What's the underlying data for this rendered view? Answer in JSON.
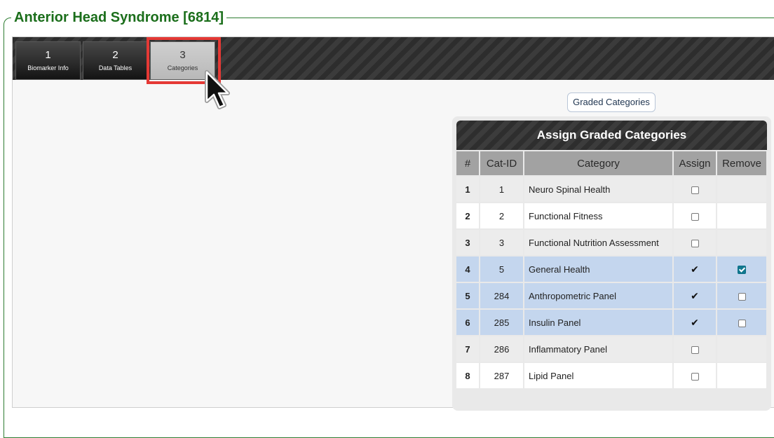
{
  "page": {
    "title": "Anterior Head Syndrome [6814]"
  },
  "tabs": [
    {
      "number": "1",
      "label": "Biomarker Info",
      "active": false
    },
    {
      "number": "2",
      "label": "Data Tables",
      "active": false
    },
    {
      "number": "3",
      "label": "Categories",
      "active": true
    }
  ],
  "graded_button": {
    "label": "Graded Categories"
  },
  "assign_table": {
    "title": "Assign Graded Categories",
    "headers": [
      "#",
      "Cat-ID",
      "Category",
      "Assign",
      "Remove"
    ],
    "rows": [
      {
        "num": "1",
        "cat_id": "1",
        "category": "Neuro Spinal Health",
        "assigned": false,
        "remove": null
      },
      {
        "num": "2",
        "cat_id": "2",
        "category": "Functional Fitness",
        "assigned": false,
        "remove": null
      },
      {
        "num": "3",
        "cat_id": "3",
        "category": "Functional Nutrition Assessment",
        "assigned": false,
        "remove": null
      },
      {
        "num": "4",
        "cat_id": "5",
        "category": "General Health",
        "assigned": true,
        "remove": true
      },
      {
        "num": "5",
        "cat_id": "284",
        "category": "Anthropometric Panel",
        "assigned": true,
        "remove": false
      },
      {
        "num": "6",
        "cat_id": "285",
        "category": "Insulin Panel",
        "assigned": true,
        "remove": false
      },
      {
        "num": "7",
        "cat_id": "286",
        "category": "Inflammatory Panel",
        "assigned": false,
        "remove": null
      },
      {
        "num": "8",
        "cat_id": "287",
        "category": "Lipid Panel",
        "assigned": false,
        "remove": null
      }
    ]
  },
  "assigned_mark": "✔",
  "colors": {
    "title_green": "#1b6e1b",
    "highlight_red": "#e53935",
    "assigned_row": "#c4d6ee",
    "checkbox_checked": "#11788f"
  }
}
